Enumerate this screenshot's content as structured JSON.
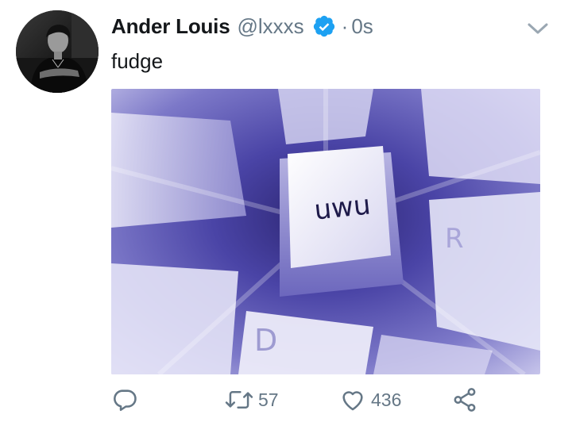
{
  "tweet": {
    "author_name": "Ander Louis",
    "author_handle": "@lxxxs",
    "separator": "·",
    "timestamp": "0s",
    "verified": true,
    "text": "fudge",
    "image": {
      "key_label": "uwu",
      "left_key_label": "D",
      "right_key_label": "R"
    }
  },
  "actions": {
    "retweet_count": "57",
    "like_count": "436"
  },
  "colors": {
    "verified": "#1da1f2",
    "muted": "#657786",
    "text": "#14171a"
  },
  "icons": [
    "verified-badge-icon",
    "caret-down-icon",
    "reply-icon",
    "retweet-icon",
    "like-icon",
    "share-icon"
  ]
}
